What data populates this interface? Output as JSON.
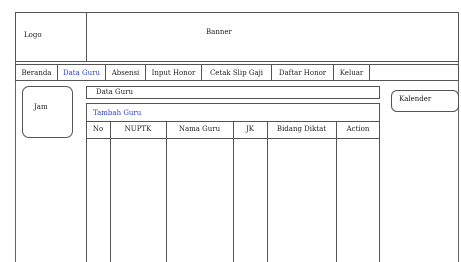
{
  "header": {
    "logo": "Logo",
    "banner": "Banner"
  },
  "nav": {
    "items": [
      {
        "label": "Beranda"
      },
      {
        "label": "Data Guru"
      },
      {
        "label": "Absensi"
      },
      {
        "label": "Input Honor"
      },
      {
        "label": "Cetak Slip Gaji"
      },
      {
        "label": "Daftar Honor"
      },
      {
        "label": "Keluar"
      }
    ],
    "active": "Data Guru"
  },
  "sidebar": {
    "clock": "Jam"
  },
  "right_panel": {
    "calendar": "Kalender"
  },
  "main": {
    "section_title": "Data Guru",
    "add_link": "Tambah Guru",
    "columns": [
      "No",
      "NUPTK",
      "Nama Guru",
      "JK",
      "Bidang Diktat",
      "Action"
    ]
  },
  "colors": {
    "link": "#2a3fe0",
    "border": "#555555"
  }
}
